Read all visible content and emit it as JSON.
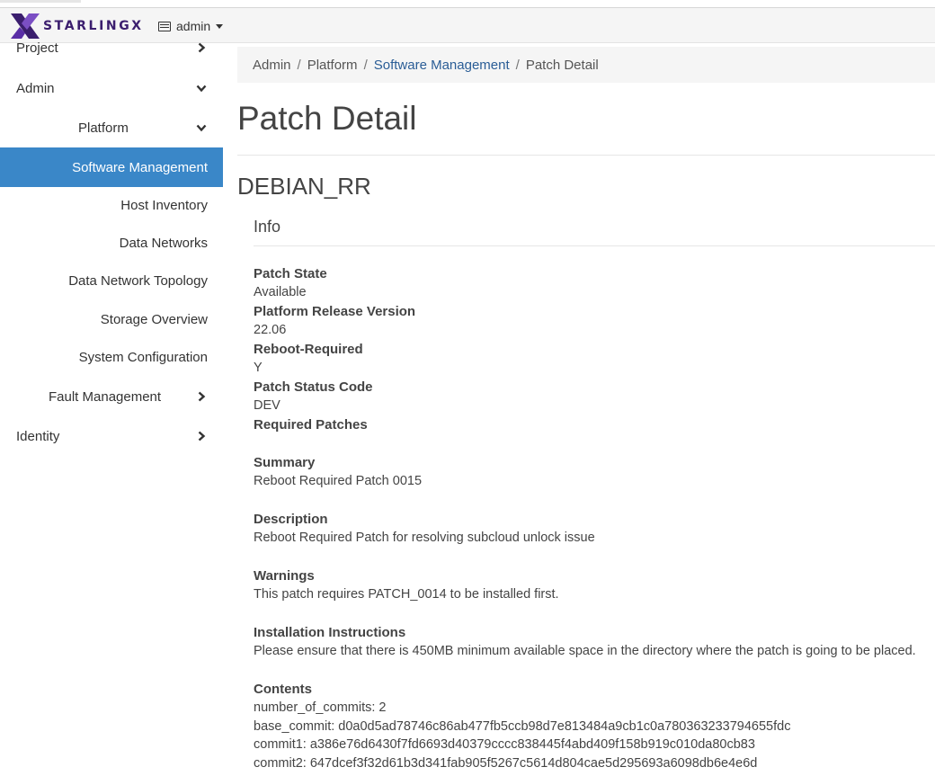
{
  "navbar": {
    "brand": "STARLINGX",
    "project_label": "admin",
    "icons": {
      "project_icon": "window-icon",
      "caret": "caret-down-icon"
    },
    "colors": {
      "brand": "#3b1e6e",
      "accent": "#3a87c8"
    }
  },
  "sidebar": {
    "items": [
      {
        "label": "Project",
        "chevron": "right"
      },
      {
        "label": "Admin",
        "chevron": "down"
      },
      {
        "label": "Platform",
        "chevron": "down"
      },
      {
        "label": "Software Management",
        "active": true
      },
      {
        "label": "Host Inventory"
      },
      {
        "label": "Data Networks"
      },
      {
        "label": "Data Network Topology"
      },
      {
        "label": "Storage Overview"
      },
      {
        "label": "System Configuration"
      },
      {
        "label": "Fault Management",
        "chevron": "right"
      },
      {
        "label": "Identity",
        "chevron": "right"
      }
    ]
  },
  "breadcrumb": {
    "items": [
      "Admin",
      "Platform",
      "Software Management",
      "Patch Detail"
    ],
    "sep": "/"
  },
  "page": {
    "title": "Patch Detail",
    "patch_name": "DEBIAN_RR",
    "section": "Info"
  },
  "details": {
    "patch_state": {
      "label": "Patch State",
      "value": "Available"
    },
    "platform_release": {
      "label": "Platform Release Version",
      "value": "22.06"
    },
    "reboot_required": {
      "label": "Reboot-Required",
      "value": "Y"
    },
    "status_code": {
      "label": "Patch Status Code",
      "value": "DEV"
    },
    "required_patches": {
      "label": "Required Patches",
      "value": ""
    },
    "summary": {
      "label": "Summary",
      "value": "Reboot Required Patch 0015"
    },
    "description": {
      "label": "Description",
      "value": "Reboot Required Patch for resolving subcloud unlock issue"
    },
    "warnings": {
      "label": "Warnings",
      "value": "This patch requires PATCH_0014 to be installed first."
    },
    "install": {
      "label": "Installation Instructions",
      "value": "Please ensure that there is 450MB minimum available space in the directory where the patch is going to be placed."
    },
    "contents": {
      "label": "Contents",
      "lines": [
        "number_of_commits: 2",
        "base_commit: d0a0d5ad78746c86ab477fb5ccb98d7e813484a9cb1c0a780363233794655fdc",
        "commit1: a386e76d6430f7fd6693d40379cccc838445f4abd409f158b919c010da80cb83",
        "commit2: 647dcef3f32d61b3d341fab905f5267c5614d804cae5d295693a6098db6e4e6d"
      ]
    }
  }
}
